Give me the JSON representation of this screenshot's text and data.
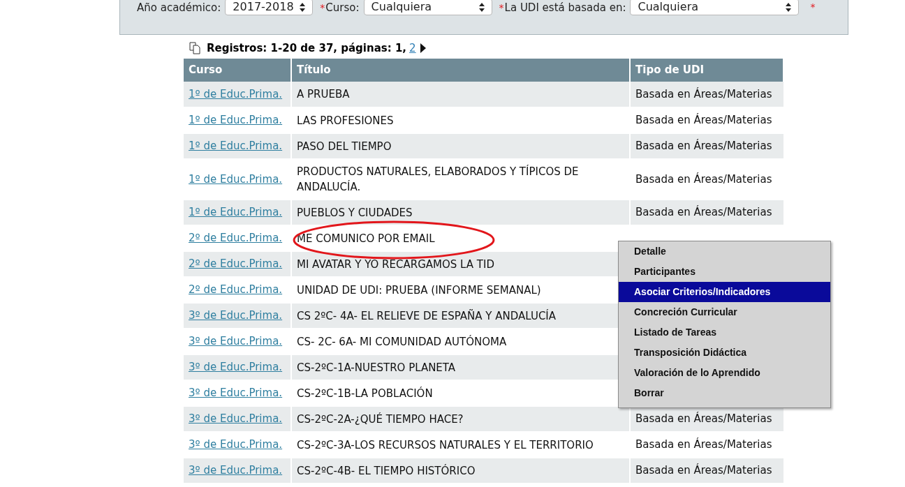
{
  "filters": [
    {
      "label": "Año académico:",
      "value": "2017-2018"
    },
    {
      "label": "Curso:",
      "required_mark": "*",
      "value": "Cualquiera"
    },
    {
      "label": "La UDI está basada en:",
      "required_mark": "*",
      "value": "Cualquiera"
    }
  ],
  "filters_trailing_mark": "*",
  "pager": {
    "summary": "Registros: 1-20 de 37, páginas: 1,",
    "next_page": "2"
  },
  "table": {
    "columns": [
      "Curso",
      "Título",
      "Tipo de UDI"
    ],
    "rows": [
      {
        "curso": "1º de Educ.Prima.",
        "titulo": "A PRUEBA",
        "tipo": "Basada en Áreas/Materias"
      },
      {
        "curso": "1º de Educ.Prima.",
        "titulo": "LAS PROFESIONES",
        "tipo": "Basada en Áreas/Materias"
      },
      {
        "curso": "1º de Educ.Prima.",
        "titulo": "PASO DEL TIEMPO",
        "tipo": "Basada en Áreas/Materias"
      },
      {
        "curso": "1º de Educ.Prima.",
        "titulo": "PRODUCTOS NATURALES, ELABORADOS Y TÍPICOS DE ANDALUCÍA.",
        "tipo": "Basada en Áreas/Materias"
      },
      {
        "curso": "1º de Educ.Prima.",
        "titulo": "PUEBLOS Y CIUDADES",
        "tipo": "Basada en Áreas/Materias"
      },
      {
        "curso": "2º de Educ.Prima.",
        "titulo": "ME COMUNICO POR EMAIL"
      },
      {
        "curso": "2º de Educ.Prima.",
        "titulo": "MI AVATAR Y YO RECARGAMOS LA TID"
      },
      {
        "curso": "2º de Educ.Prima.",
        "titulo": "UNIDAD DE UDI: PRUEBA (INFORME SEMANAL)"
      },
      {
        "curso": "3º de Educ.Prima.",
        "titulo": "CS 2ºC- 4A- EL RELIEVE DE ESPAÑA Y ANDALUCÍA"
      },
      {
        "curso": "3º de Educ.Prima.",
        "titulo": "CS- 2C- 6A- MI COMUNIDAD AUTÓNOMA"
      },
      {
        "curso": "3º de Educ.Prima.",
        "titulo": "CS-2ºC-1A-NUESTRO PLANETA"
      },
      {
        "curso": "3º de Educ.Prima.",
        "titulo": "CS-2ºC-1B-LA POBLACIÓN"
      },
      {
        "curso": "3º de Educ.Prima.",
        "titulo": "CS-2ºC-2A-¿QUÉ TIEMPO HACE?",
        "tipo": "Basada en Áreas/Materias"
      },
      {
        "curso": "3º de Educ.Prima.",
        "titulo": "CS-2ºC-3A-LOS RECURSOS NATURALES Y EL TERRITORIO",
        "tipo": "Basada en Áreas/Materias"
      },
      {
        "curso": "3º de Educ.Prima.",
        "titulo": "CS-2ºC-4B- EL TIEMPO HISTÓRICO",
        "tipo": "Basada en Áreas/Materias"
      }
    ]
  },
  "context_menu": {
    "items": [
      {
        "label": "Detalle",
        "selected": false
      },
      {
        "label": "Participantes",
        "selected": false
      },
      {
        "label": "Asociar Criterios/Indicadores",
        "selected": true
      },
      {
        "label": "Concreción Curricular",
        "selected": false
      },
      {
        "label": "Listado de Tareas",
        "selected": false
      },
      {
        "label": "Transposición Didáctica",
        "selected": false
      },
      {
        "label": "Valoración de lo Aprendido",
        "selected": false
      },
      {
        "label": "Borrar",
        "selected": false
      }
    ]
  }
}
